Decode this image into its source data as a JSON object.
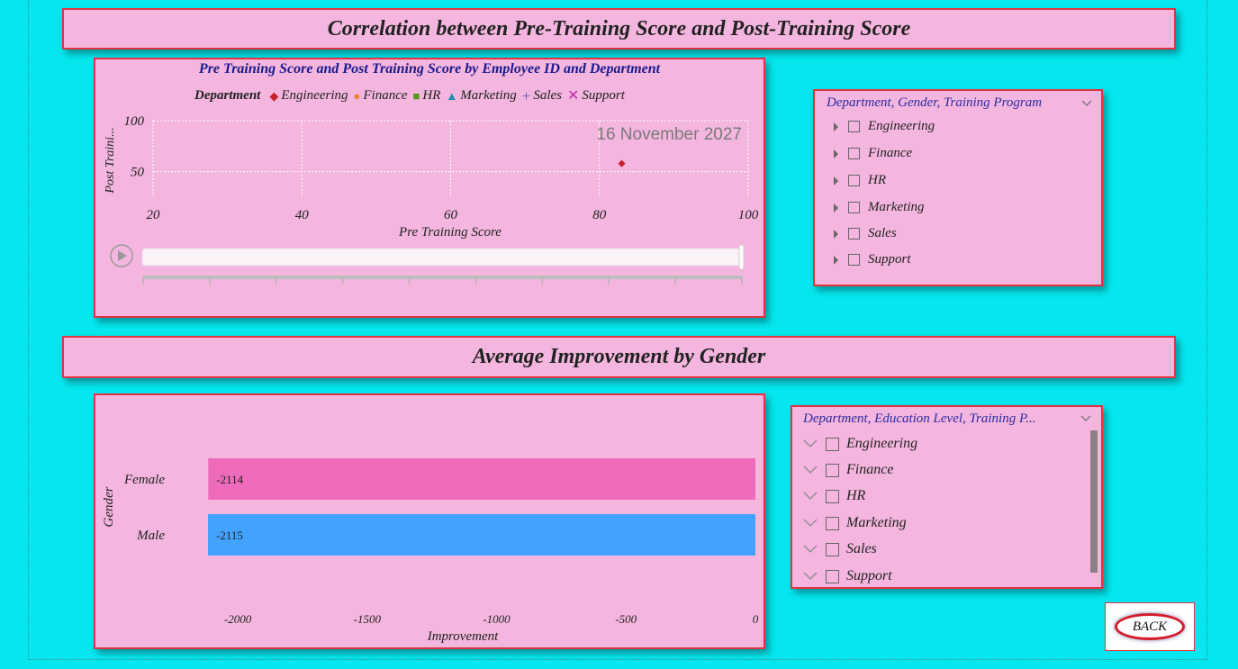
{
  "banner1": {
    "title": "Correlation between Pre-Training Score and Post-Training Score"
  },
  "banner2": {
    "title": "Average Improvement by Gender"
  },
  "scatter": {
    "title": "Pre Training Score and Post Training Score by Employee ID and Department",
    "legend_title": "Department",
    "legend": [
      {
        "label": "Engineering",
        "marker": "diamond",
        "color": "#c8202c"
      },
      {
        "label": "Finance",
        "marker": "circle",
        "color": "#e8862a"
      },
      {
        "label": "HR",
        "marker": "square",
        "color": "#4f9a1c"
      },
      {
        "label": "Marketing",
        "marker": "triangle",
        "color": "#1f8fb0"
      },
      {
        "label": "Sales",
        "marker": "plus",
        "color": "#6a5ab8"
      },
      {
        "label": "Support",
        "marker": "x",
        "color": "#c02ca8"
      }
    ],
    "watermark_date": "16 November 2027",
    "play_icon": "play-icon"
  },
  "slicer1": {
    "header": "Department, Gender, Training Program",
    "items": [
      "Engineering",
      "Finance",
      "HR",
      "Marketing",
      "Sales",
      "Support"
    ]
  },
  "slicer2": {
    "header": "Department, Education Level, Training P...",
    "items": [
      "Engineering",
      "Finance",
      "HR",
      "Marketing",
      "Sales",
      "Support"
    ]
  },
  "back_button": {
    "label": "BACK"
  },
  "chart_data": [
    {
      "type": "scatter",
      "title": "Pre Training Score and Post Training Score by Employee ID and Department",
      "xlabel": "Pre Training Score",
      "ylabel": "Post Traini...",
      "xlim": [
        20,
        100
      ],
      "ylim": [
        25,
        100
      ],
      "x_ticks": [
        20,
        40,
        60,
        80,
        100
      ],
      "y_ticks": [
        50,
        100
      ],
      "grid": true,
      "legend_position": "top",
      "series": [
        {
          "name": "Engineering",
          "points": [
            {
              "x": 83,
              "y": 58
            }
          ]
        }
      ]
    },
    {
      "type": "bar",
      "orientation": "horizontal",
      "categories": [
        "Female",
        "Male"
      ],
      "values": [
        -2114,
        -2115
      ],
      "colors": [
        "#ee6abb",
        "#42a3ff"
      ],
      "xlabel": "Improvement",
      "ylabel": "Gender",
      "x_ticks": [
        -2000,
        -1500,
        -1000,
        -500,
        0
      ],
      "xlim": [
        -2115,
        0
      ]
    }
  ]
}
